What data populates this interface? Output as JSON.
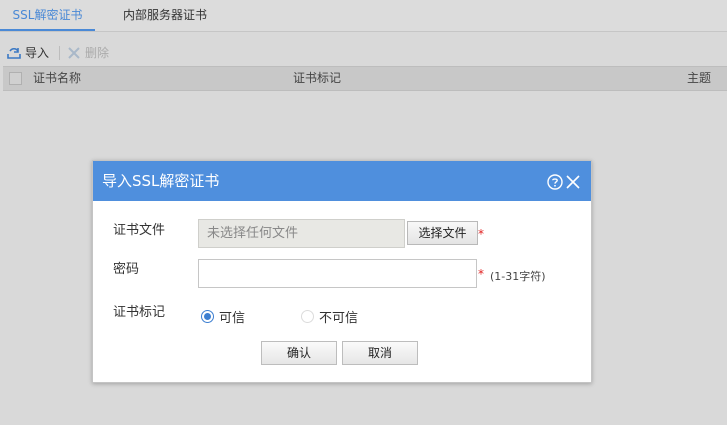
{
  "tabs": [
    {
      "label": "SSL解密证书",
      "active": true
    },
    {
      "label": "内部服务器证书",
      "active": false
    }
  ],
  "toolbar": {
    "import_label": "导入",
    "delete_label": "删除"
  },
  "table": {
    "columns": [
      "证书名称",
      "证书标记",
      "主题"
    ]
  },
  "dialog": {
    "title": "导入SSL解密证书",
    "file_label": "证书文件",
    "file_placeholder": "未选择任何文件",
    "choose_button": "选择文件",
    "password_label": "密码",
    "password_value": "",
    "password_hint": "(1-31字符)",
    "required_mark": "*",
    "mark_label": "证书标记",
    "mark_options": [
      {
        "label": "可信",
        "selected": true
      },
      {
        "label": "不可信",
        "selected": false
      }
    ],
    "ok_button": "确认",
    "cancel_button": "取消"
  },
  "colors": {
    "accent": "#4a89d6",
    "dialog_header": "#4f8fdd",
    "required": "#e02020"
  },
  "icons": {
    "import": "import-icon",
    "delete": "delete-icon",
    "help": "help-icon",
    "close": "close-icon"
  }
}
